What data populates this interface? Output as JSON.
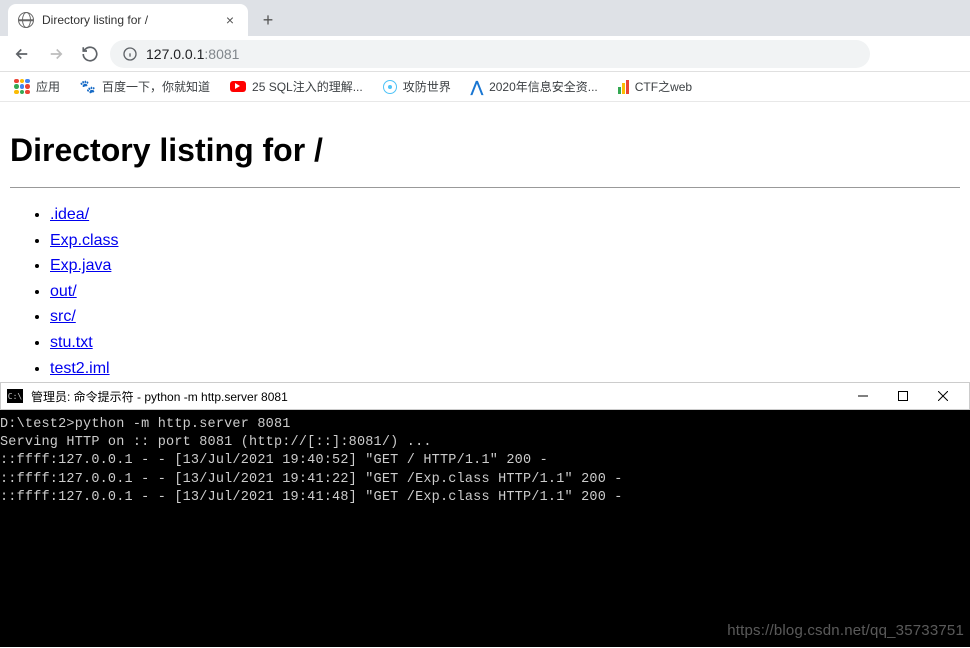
{
  "tab": {
    "title": "Directory listing for /"
  },
  "address": {
    "host": "127.0.0.1",
    "port": ":8081"
  },
  "bookmarks": {
    "apps": "应用",
    "items": [
      "百度一下，你就知道",
      "25 SQL注入的理解...",
      "攻防世界",
      "2020年信息安全资...",
      "CTF之web"
    ]
  },
  "page": {
    "heading": "Directory listing for /",
    "files": [
      ".idea/",
      "Exp.class",
      "Exp.java",
      "out/",
      "src/",
      "stu.txt",
      "test2.iml"
    ]
  },
  "terminal": {
    "title": "管理员: 命令提示符 - python  -m http.server 8081",
    "lines": [
      "D:\\test2>python -m http.server 8081",
      "Serving HTTP on :: port 8081 (http://[::]:8081/) ...",
      "::ffff:127.0.0.1 - - [13/Jul/2021 19:40:52] \"GET / HTTP/1.1\" 200 -",
      "::ffff:127.0.0.1 - - [13/Jul/2021 19:41:22] \"GET /Exp.class HTTP/1.1\" 200 -",
      "::ffff:127.0.0.1 - - [13/Jul/2021 19:41:48] \"GET /Exp.class HTTP/1.1\" 200 -"
    ]
  },
  "watermark": "https://blog.csdn.net/qq_35733751"
}
